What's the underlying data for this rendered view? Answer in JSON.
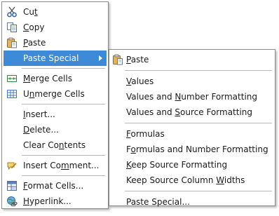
{
  "main_menu": {
    "items": [
      {
        "pre": "Cu",
        "key": "t",
        "post": "",
        "icon": "scissors-icon"
      },
      {
        "pre": "",
        "key": "C",
        "post": "opy",
        "icon": "copy-icon"
      },
      {
        "pre": "",
        "key": "P",
        "post": "aste",
        "icon": "paste-icon"
      },
      {
        "pre": "Paste Special",
        "key": "",
        "post": "",
        "icon": ""
      },
      {
        "pre": "",
        "key": "M",
        "post": "erge Cells",
        "icon": "merge-cells-icon"
      },
      {
        "pre": "U",
        "key": "n",
        "post": "merge Cells",
        "icon": "unmerge-cells-icon"
      },
      {
        "pre": "",
        "key": "I",
        "post": "nsert...",
        "icon": ""
      },
      {
        "pre": "",
        "key": "D",
        "post": "elete...",
        "icon": ""
      },
      {
        "pre": "Clear Co",
        "key": "n",
        "post": "tents",
        "icon": ""
      },
      {
        "pre": "Insert Co",
        "key": "m",
        "post": "ment...",
        "icon": "insert-comment-icon"
      },
      {
        "pre": "",
        "key": "F",
        "post": "ormat Cells...",
        "icon": "format-cells-icon"
      },
      {
        "pre": "",
        "key": "H",
        "post": "yperlink...",
        "icon": "hyperlink-icon"
      }
    ]
  },
  "sub_menu": {
    "items": [
      {
        "pre": "",
        "key": "P",
        "post": "aste",
        "icon": "paste-icon"
      },
      {
        "pre": "",
        "key": "V",
        "post": "alues"
      },
      {
        "pre": "Values and ",
        "key": "N",
        "post": "umber Formatting"
      },
      {
        "pre": "Values and ",
        "key": "S",
        "post": "ource Formatting"
      },
      {
        "pre": "",
        "key": "F",
        "post": "ormulas"
      },
      {
        "pre": "F",
        "key": "o",
        "post": "rmulas and Number Formatting"
      },
      {
        "pre": "",
        "key": "K",
        "post": "eep Source Formatting"
      },
      {
        "pre": "Keep Source Column ",
        "key": "W",
        "post": "idths"
      },
      {
        "pre": "Paste Special...",
        "key": "",
        "post": ""
      }
    ]
  },
  "colors": {
    "highlight": "#3d8ad8",
    "border": "#8a8a8a",
    "separator": "#b9b9b9"
  }
}
